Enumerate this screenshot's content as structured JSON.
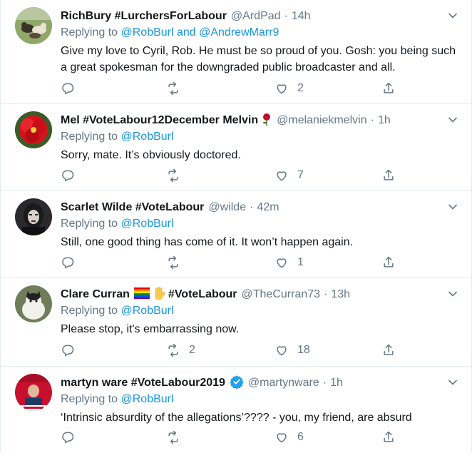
{
  "tweets": [
    {
      "name": "RichBury #LurchersForLabour",
      "handle": "@ArdPad",
      "separator": "·",
      "time": "14h",
      "replying_prefix": "Replying to ",
      "mention_1": "@RobBurl",
      "replying_join": " and ",
      "mention_2": "@AndrewMarr9",
      "text": "Give my love to Cyril, Rob. He must be so proud of you. Gosh: you being such a great spokesman for the downgraded public broadcaster and all.",
      "retweets": "",
      "likes": "2",
      "avatar": "dogs-on-grass-photo"
    },
    {
      "name": "Mel #VoteLabour12December Melvin",
      "emoji": "rose-emoji",
      "handle": "@melaniekmelvin",
      "separator": "·",
      "time": "1h",
      "replying_prefix": "Replying to ",
      "mention_1": "@RobBurl",
      "text": "Sorry, mate. It’s obviously doctored.",
      "retweets": "",
      "likes": "7",
      "avatar": "red-flower-photo"
    },
    {
      "name": "Scarlet Wilde #VoteLabour",
      "handle": "@wilde",
      "separator": "·",
      "time": "42m",
      "replying_prefix": "Replying to ",
      "mention_1": "@RobBurl",
      "text": "Still, one good thing has come of it.  It won’t happen again.",
      "retweets": "",
      "likes": "1",
      "avatar": "gothic-portrait-photo"
    },
    {
      "name": "Clare Curran",
      "emoji": "rainbow-flag-and-raised-hand-emoji",
      "name_suffix": "#VoteLabour",
      "handle": "@TheCurran73",
      "separator": "·",
      "time": "13h",
      "replying_prefix": "Replying to ",
      "mention_1": "@RobBurl",
      "text": "Please stop, it's embarrassing now.",
      "retweets": "2",
      "likes": "18",
      "avatar": "cat-photo"
    },
    {
      "name": "martyn ware #VoteLabour2019",
      "verified": "verified-badge-icon",
      "handle": "@martynware",
      "separator": "·",
      "time": "1h",
      "replying_prefix": "Replying to ",
      "mention_1": "@RobBurl",
      "text": "‘Intrinsic absurdity of the allegations’???? - you, my friend, are absurd",
      "retweets": "",
      "likes": "6",
      "avatar": "vote-labour-portrait-photo"
    }
  ],
  "colors": {
    "link": "#1b95e0",
    "secondary_text": "#657786",
    "primary_text": "#14171a",
    "divider": "#e6ecf0",
    "verified": "#1da1f2"
  }
}
